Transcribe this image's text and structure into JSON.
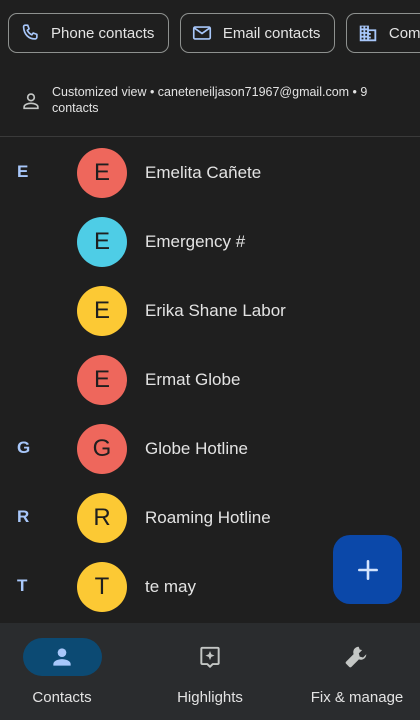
{
  "filters": {
    "phone": {
      "label": "Phone contacts",
      "icon": "phone-icon"
    },
    "email": {
      "label": "Email contacts",
      "icon": "mail-icon"
    },
    "company": {
      "label": "Company",
      "icon": "building-icon"
    }
  },
  "view_info": {
    "icon": "person-icon",
    "text": "Customized view • caneteneiljason71967@gmail.com • 9 contacts"
  },
  "contacts": [
    {
      "section": "E",
      "initial": "E",
      "name": "Emelita Cañete",
      "color": "#ee675c"
    },
    {
      "section": "",
      "initial": "E",
      "name": "Emergency #",
      "color": "#4ecde6"
    },
    {
      "section": "",
      "initial": "E",
      "name": "Erika Shane Labor",
      "color": "#fcc934"
    },
    {
      "section": "",
      "initial": "E",
      "name": "Ermat Globe",
      "color": "#ee675c"
    },
    {
      "section": "G",
      "initial": "G",
      "name": "Globe Hotline",
      "color": "#ee675c"
    },
    {
      "section": "R",
      "initial": "R",
      "name": "Roaming Hotline",
      "color": "#fcc934"
    },
    {
      "section": "T",
      "initial": "T",
      "name": "te may",
      "color": "#fcc934"
    }
  ],
  "fab": {
    "icon": "plus-icon"
  },
  "bottom_nav": [
    {
      "label": "Contacts",
      "icon": "person-icon",
      "active": true
    },
    {
      "label": "Highlights",
      "icon": "highlights-icon",
      "active": false
    },
    {
      "label": "Fix & manage",
      "icon": "wrench-icon",
      "active": false
    }
  ],
  "colors": {
    "background": "#1f1f1f",
    "section_letter": "#a8c7fa",
    "fab": "#0b48a9",
    "nav_active_pill": "#0c4a73",
    "nav_background": "#2a2c2e"
  }
}
